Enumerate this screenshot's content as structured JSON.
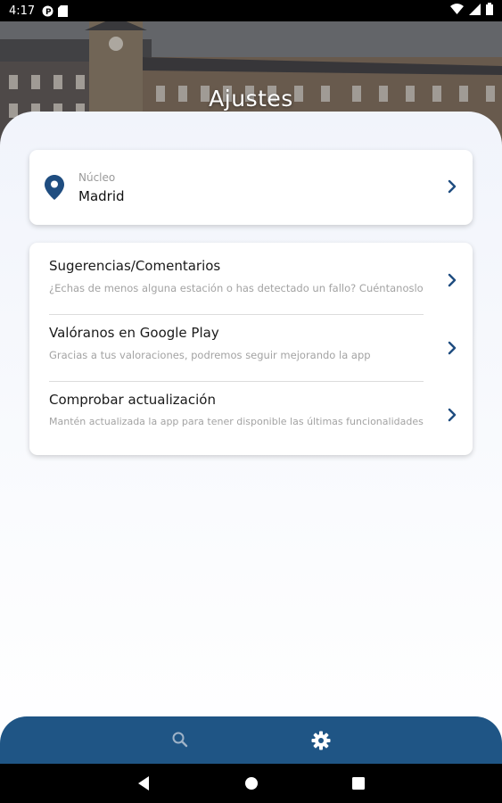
{
  "status_bar": {
    "time": "4:17",
    "icons": [
      "p-icon",
      "sd-card-icon",
      "wifi-icon",
      "signal-icon",
      "battery-icon"
    ]
  },
  "header": {
    "title": "Ajustes"
  },
  "nucleo_card": {
    "label": "Núcleo",
    "value": "Madrid",
    "icon": "location-pin-icon"
  },
  "options": [
    {
      "title": "Sugerencias/Comentarios",
      "subtitle": "¿Echas de menos alguna estación o has detectado un fallo? Cuéntanoslo"
    },
    {
      "title": "Valóranos en Google Play",
      "subtitle": "Gracias a tus valoraciones, podremos seguir mejorando la app"
    },
    {
      "title": "Comprobar actualización",
      "subtitle": "Mantén actualizada la app para tener disponible las últimas funcionalidades"
    }
  ],
  "bottom_nav": {
    "items": [
      "search-icon",
      "settings-icon"
    ],
    "active": "settings-icon"
  },
  "colors": {
    "accent": "#1f5585",
    "chevron": "#1f4d80",
    "pin": "#1f4d80"
  }
}
